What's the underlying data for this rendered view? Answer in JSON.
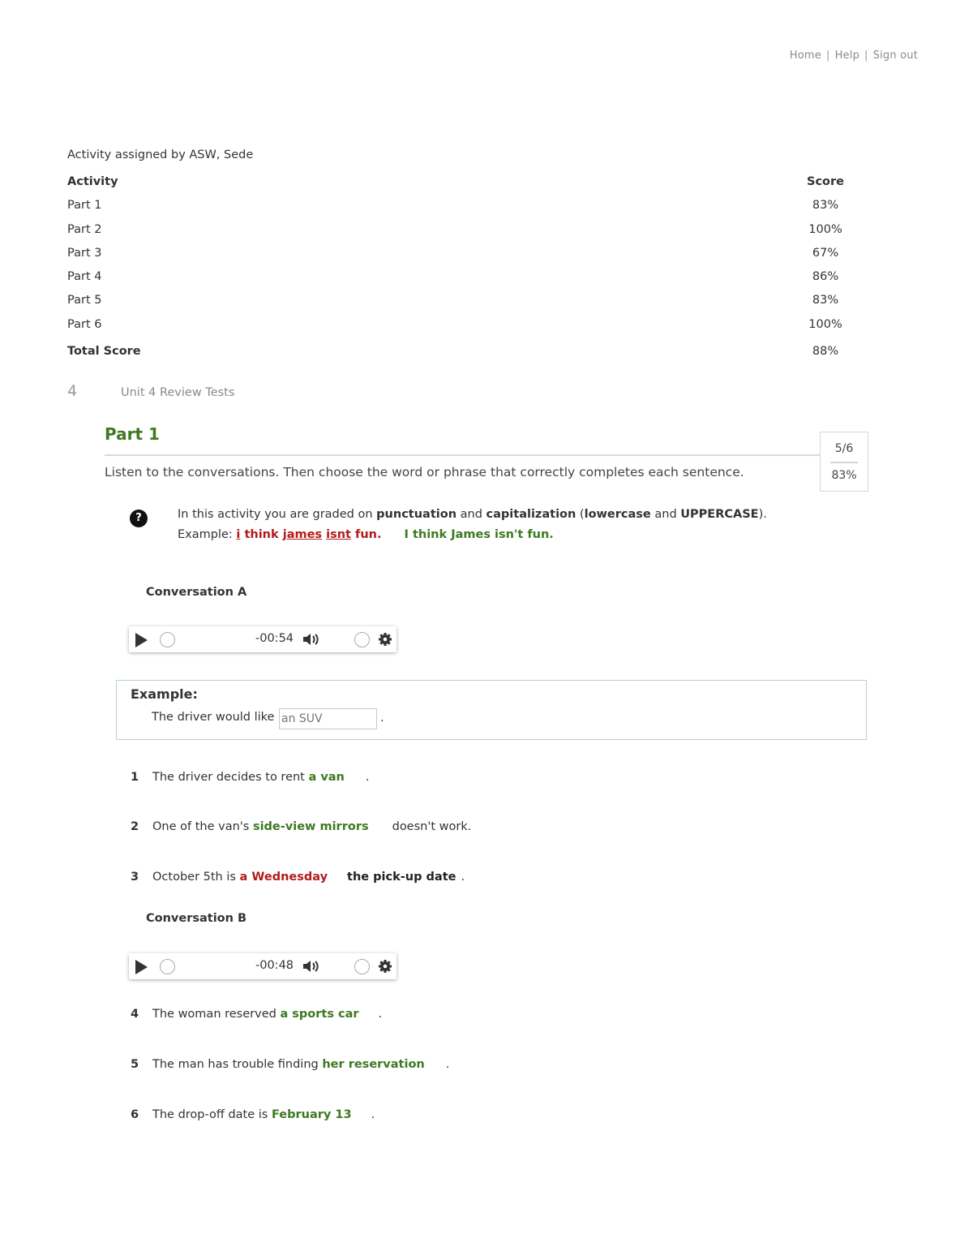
{
  "nav": {
    "home": "Home",
    "help": "Help",
    "signout": "Sign out",
    "separator": "|"
  },
  "assigned_by": "Activity assigned by ASW, Sede",
  "scores": {
    "header_activity": "Activity",
    "header_score": "Score",
    "rows": [
      {
        "name": "Part 1",
        "score": "83%"
      },
      {
        "name": "Part 2",
        "score": "100%"
      },
      {
        "name": "Part 3",
        "score": "67%"
      },
      {
        "name": "Part 4",
        "score": "86%"
      },
      {
        "name": "Part 5",
        "score": "83%"
      },
      {
        "name": "Part 6",
        "score": "100%"
      }
    ],
    "total_label": "Total Score",
    "total_value": "88%"
  },
  "unit": {
    "number": "4",
    "title": "Unit 4 Review Tests"
  },
  "part": {
    "title": "Part 1",
    "instructions": "Listen to the conversations. Then choose the word or phrase that correctly completes each sentence.",
    "score_fraction": "5/6",
    "score_percent": "83%"
  },
  "grading_note": {
    "prefix": "In this activity you are graded on ",
    "punctuation": "punctuation",
    "and1": " and ",
    "capitalization": "capitalization",
    "open": " (",
    "lowercase": "lowercase",
    "and2": " and ",
    "uppercase": "UPPERCASE",
    "close": ").",
    "example_label": "Example: ",
    "wrong_1": "i",
    "wrong_2": "think",
    "wrong_3": "james",
    "wrong_4": "isnt",
    "wrong_5": "fun.",
    "correct": "I think James isn't fun."
  },
  "conversation_a": {
    "label": "Conversation A",
    "time": "-00:54"
  },
  "conversation_b": {
    "label": "Conversation B",
    "time": "-00:48"
  },
  "example": {
    "title": "Example:",
    "sentence": "The driver would like",
    "input_value": "an SUV",
    "end": "."
  },
  "questions": [
    {
      "num": "1",
      "before": "The driver decides to rent ",
      "answer": "a van",
      "after": "."
    },
    {
      "num": "2",
      "before": "One of the van's ",
      "answer": "side-view mirrors",
      "after": "doesn't work."
    },
    {
      "num": "3",
      "before": "October 5th is ",
      "answer": "a Wednesday",
      "correction": "the pick-up date",
      "after": "."
    },
    {
      "num": "4",
      "before": "The woman reserved ",
      "answer": "a sports car",
      "after": "."
    },
    {
      "num": "5",
      "before": "The man has trouble finding ",
      "answer": "her reservation",
      "after": "."
    },
    {
      "num": "6",
      "before": "The drop-off date is ",
      "answer": "February 13",
      "after": "."
    }
  ],
  "colors": {
    "correct": "#3d7a21",
    "incorrect": "#b31b1b",
    "accent_border": "#b8cfe0"
  },
  "icons": [
    "help-icon",
    "play-icon",
    "volume-icon",
    "settings-gear-icon"
  ]
}
